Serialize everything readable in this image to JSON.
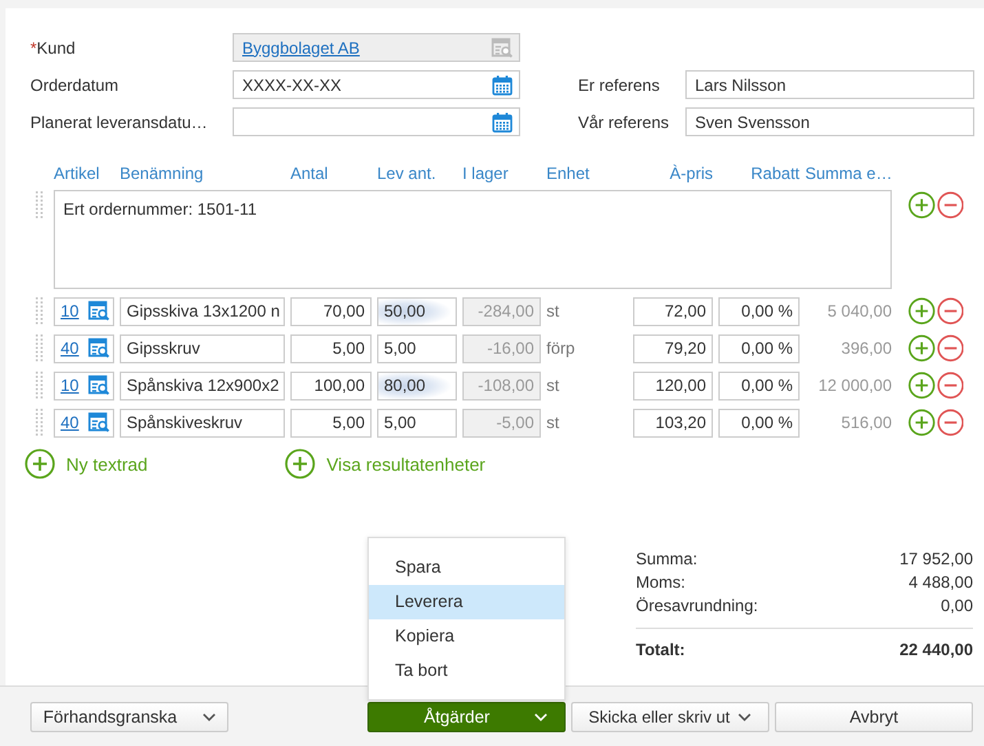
{
  "form": {
    "customer": {
      "label": "Kund",
      "required_mark": "*",
      "disabled": true,
      "value": "Byggbolaget AB"
    },
    "order_date": {
      "label": "Orderdatum",
      "value": "XXXX-XX-XX"
    },
    "planned_delivery": {
      "label": "Planerat leveransdatu…"
    },
    "your_reference": {
      "label": "Er referens",
      "value": "Lars Nilsson"
    },
    "our_reference": {
      "label": "Vår referens",
      "value": "Sven Svensson"
    }
  },
  "table": {
    "columns": [
      "Artikel",
      "Benämning",
      "Antal",
      "Lev ant.",
      "I lager",
      "Enhet",
      "À-pris",
      "Rabatt",
      "Summa e…"
    ],
    "rows": [
      {
        "kind": "text",
        "text": "Ert ordernummer: 1501-11"
      },
      {
        "kind": "article",
        "article": "10",
        "name": "Gipsskiva 13x1200 n",
        "quantity": "70,00",
        "delivered": "50,00",
        "highlighted": true,
        "in_stock": "-284,00",
        "unit": "st",
        "price": "72,00",
        "discount": "0,00 %",
        "sum": "5 040,00"
      },
      {
        "kind": "article",
        "article": "40",
        "name": "Gipsskruv",
        "quantity": "5,00",
        "delivered": "5,00",
        "highlighted": false,
        "in_stock": "-16,00",
        "unit": "förp",
        "price": "79,20",
        "discount": "0,00 %",
        "sum": "396,00"
      },
      {
        "kind": "article",
        "article": "10",
        "name": "Spånskiva 12x900x2",
        "quantity": "100,00",
        "delivered": "80,00",
        "highlighted": true,
        "in_stock": "-108,00",
        "unit": "st",
        "price": "120,00",
        "discount": "0,00 %",
        "sum": "12 000,00"
      },
      {
        "kind": "article",
        "article": "40",
        "name": "Spånskiveskruv",
        "quantity": "5,00",
        "delivered": "5,00",
        "highlighted": false,
        "in_stock": "-5,00",
        "unit": "st",
        "price": "103,20",
        "discount": "0,00 %",
        "sum": "516,00"
      }
    ]
  },
  "add_links": [
    "Ny textrad",
    "Visa resultatenheter"
  ],
  "totals": [
    {
      "label": "Summa:",
      "value": "17 952,00"
    },
    {
      "label": "Moms:",
      "value": "4 488,00"
    },
    {
      "label": "Öresavrundning:",
      "value": "0,00"
    }
  ],
  "total": {
    "label": "Totalt:",
    "value": "22 440,00"
  },
  "actions_menu": {
    "items": [
      {
        "label": "Spara",
        "selected": false
      },
      {
        "label": "Leverera",
        "selected": true
      },
      {
        "label": "Kopiera",
        "selected": false
      },
      {
        "label": "Ta bort",
        "selected": false
      }
    ]
  },
  "footer_buttons": [
    {
      "label": "Förhandsgranska",
      "kind": "dropdown"
    },
    {
      "label": "Åtgärder",
      "kind": "primary"
    },
    {
      "label": "Skicka eller skriv ut",
      "kind": "dropdown"
    },
    {
      "label": "Avbryt",
      "kind": "plain"
    }
  ]
}
